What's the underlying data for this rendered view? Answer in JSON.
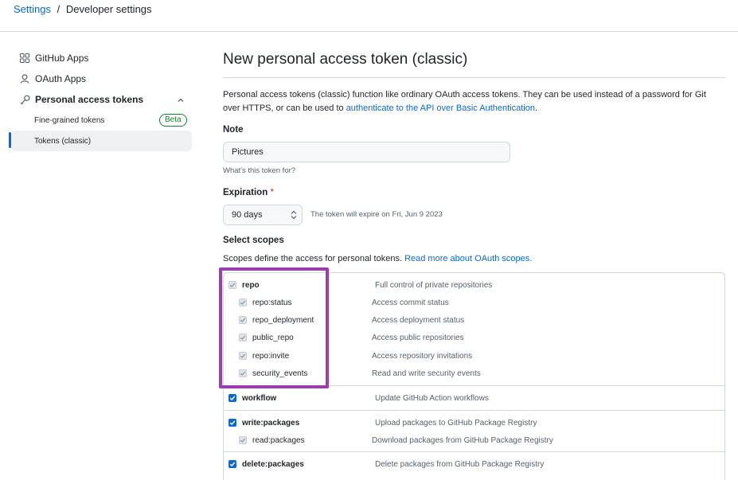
{
  "breadcrumb": {
    "settings": "Settings",
    "separator": "/",
    "current": "Developer settings"
  },
  "sidebar": {
    "items": [
      {
        "label": "GitHub Apps",
        "icon": "apps-grid-icon"
      },
      {
        "label": "OAuth Apps",
        "icon": "person-icon"
      },
      {
        "label": "Personal access tokens",
        "icon": "key-icon"
      }
    ],
    "sub_items": [
      {
        "label": "Fine-grained tokens",
        "badge": "Beta"
      },
      {
        "label": "Tokens (classic)"
      }
    ]
  },
  "main": {
    "title": "New personal access token (classic)",
    "intro_text": "Personal access tokens (classic) function like ordinary OAuth access tokens. They can be used instead of a password for Git over HTTPS, or can be used to ",
    "intro_link": "authenticate to the API over Basic Authentication",
    "intro_end": ".",
    "note_label": "Note",
    "note_value": "Pictures",
    "note_hint": "What's this token for?",
    "expiration_label": "Expiration",
    "required_mark": "*",
    "expiration_value": "90 days",
    "expiration_note": "The token will expire on Fri, Jun 9 2023",
    "scopes_label": "Select scopes",
    "scopes_desc": "Scopes define the access for personal tokens. ",
    "scopes_link": "Read more about OAuth scopes."
  },
  "scopes": {
    "repo": {
      "name": "repo",
      "desc": "Full control of private repositories"
    },
    "repo_status": {
      "name": "repo:status",
      "desc": "Access commit status"
    },
    "repo_deployment": {
      "name": "repo_deployment",
      "desc": "Access deployment status"
    },
    "public_repo": {
      "name": "public_repo",
      "desc": "Access public repositories"
    },
    "repo_invite": {
      "name": "repo:invite",
      "desc": "Access repository invitations"
    },
    "security_events": {
      "name": "security_events",
      "desc": "Read and write security events"
    },
    "workflow": {
      "name": "workflow",
      "desc": "Update GitHub Action workflows"
    },
    "write_packages": {
      "name": "write:packages",
      "desc": "Upload packages to GitHub Package Registry"
    },
    "read_packages": {
      "name": "read:packages",
      "desc": "Download packages from GitHub Package Registry"
    },
    "delete_packages": {
      "name": "delete:packages",
      "desc": "Delete packages from GitHub Package Registry"
    }
  },
  "colors": {
    "accent": "#0969da",
    "highlight": "#9b3fb0",
    "badge_green": "#1a7f37"
  }
}
